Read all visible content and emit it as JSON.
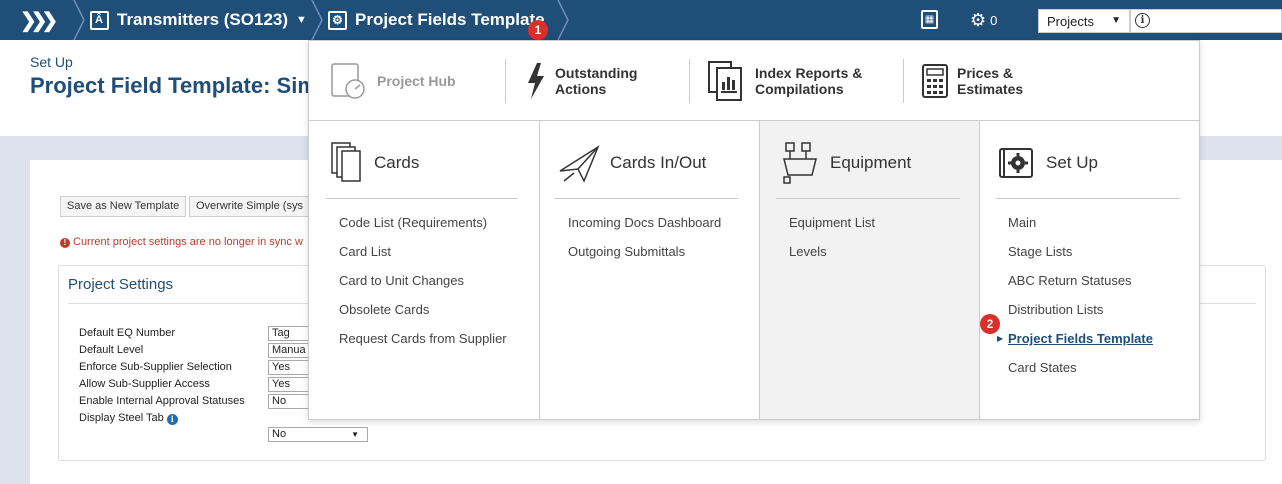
{
  "topbar": {
    "home_icon": "double-chevron-icon",
    "transmitters": "Transmitters (SO123)",
    "project_fields": "Project Fields Template",
    "badge_1": "1",
    "cogs_count": "0",
    "projects_select": "Projects",
    "colors": {
      "bar": "#1f4e79",
      "badge": "#d9302c"
    }
  },
  "page": {
    "setup_label": "Set Up",
    "title": "Project Field Template: Sim",
    "save_btn": "Save as New Template",
    "overwrite_btn": "Overwrite Simple (sys",
    "warning": "Current project settings are no longer in sync w",
    "project_settings": {
      "title": "Project Settings",
      "rows": [
        {
          "label": "Default EQ Number",
          "value": "Tag"
        },
        {
          "label": "Default Level",
          "value": "Manua"
        },
        {
          "label": "Enforce Sub-Supplier Selection",
          "value": "Yes"
        },
        {
          "label": "Allow Sub-Supplier Access",
          "value": "Yes"
        },
        {
          "label": "Enable Internal Approval Statuses",
          "value": "No"
        },
        {
          "label": "Display Steel Tab",
          "value": "No"
        }
      ]
    }
  },
  "mega_menu": {
    "top_items": [
      {
        "label": "Project Hub",
        "icon": "gauge-icon"
      },
      {
        "label1": "Outstanding",
        "label2": "Actions",
        "icon": "lightning-icon"
      },
      {
        "label1": "Index Reports &",
        "label2": "Compilations",
        "icon": "report-icon"
      },
      {
        "label1": "Prices &",
        "label2": "Estimates",
        "icon": "calculator-icon"
      }
    ],
    "columns": [
      {
        "title": "Cards",
        "items": [
          "Code List (Requirements)",
          "Card List",
          "Card to Unit Changes",
          "Obsolete Cards",
          "Request Cards from Supplier"
        ]
      },
      {
        "title": "Cards In/Out",
        "items": [
          "Incoming Docs Dashboard",
          "Outgoing Submittals"
        ]
      },
      {
        "title": "Equipment",
        "items": [
          "Equipment List",
          "Levels"
        ]
      },
      {
        "title": "Set Up",
        "items": [
          "Main",
          "Stage Lists",
          "ABC Return Statuses",
          "Distribution Lists",
          "Project Fields Template",
          "Card States"
        ]
      }
    ],
    "badge_2": "2"
  }
}
